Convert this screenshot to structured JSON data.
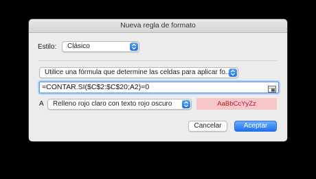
{
  "dialog": {
    "title": "Nueva regla de formato",
    "style_label": "Estilo:",
    "style_value": "Clásico",
    "rule_type": "Utilice una fórmula que determine las celdas para aplicar fo...",
    "formula": "=CONTAR.SI($C$2:$C$20;A2)=0",
    "format_prefix": "A",
    "format_value": "Relleno rojo claro con texto rojo oscuro",
    "preview_text": "AaBbCcYyZz",
    "cancel_label": "Cancelar",
    "accept_label": "Aceptar"
  },
  "colors": {
    "accent": "#1e72f1",
    "preview_fill": "#f7c6c9",
    "preview_text": "#b0151f"
  },
  "icons": {
    "popup_arrows": "chevron-updown-icon",
    "range_selector": "range-select-icon"
  }
}
